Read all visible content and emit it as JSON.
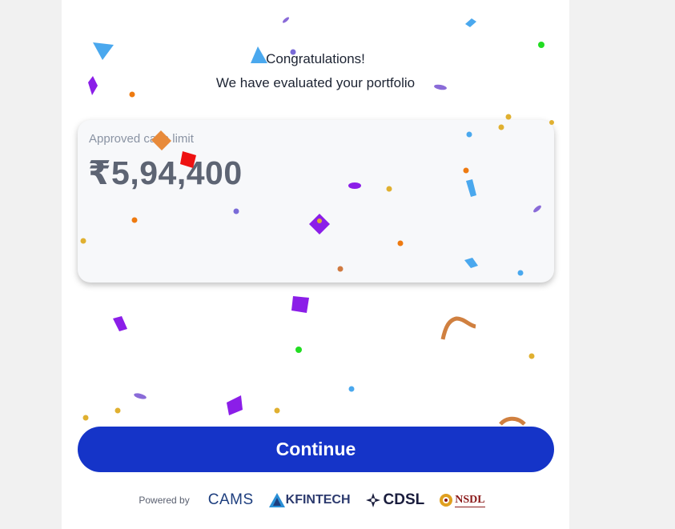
{
  "header": {
    "title_line1": "Congratulations!",
    "title_line2": "We have evaluated your portfolio"
  },
  "card": {
    "label": "Approved cash limit",
    "amount": "₹5,94,400"
  },
  "actions": {
    "continue_label": "Continue"
  },
  "footer": {
    "powered_by": "Powered by",
    "logos": {
      "cams": "CAMS",
      "kfintech": "KFINTECH",
      "cdsl": "CDSL",
      "nsdl": "NSDL"
    }
  },
  "colors": {
    "primary_button": "#1534c8",
    "card_background": "#f7f8fa",
    "amount_text": "#5d6473"
  },
  "decor": {
    "confetti": "confetti-overlay"
  }
}
